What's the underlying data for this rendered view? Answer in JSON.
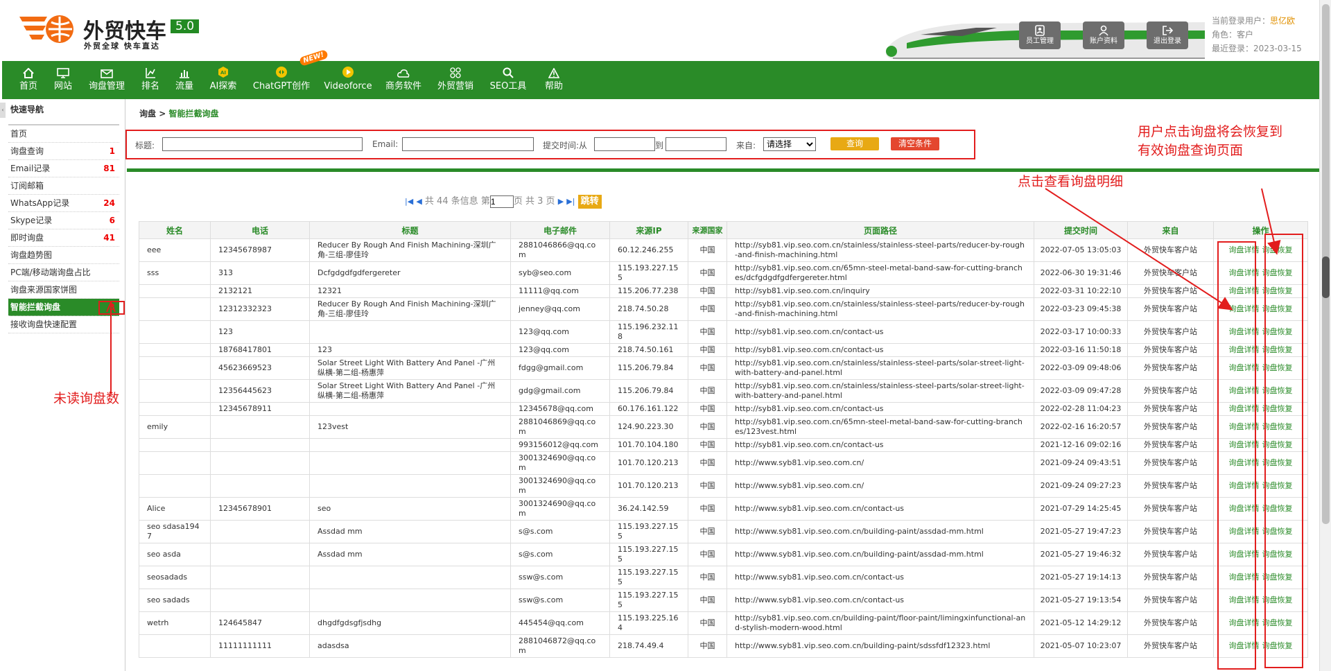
{
  "header": {
    "logo_title": "外贸快车",
    "logo_slogan": "外贸全球 快车直达",
    "version": "5.0",
    "buttons": [
      {
        "label": "员工管理",
        "icon": "staff-icon"
      },
      {
        "label": "账户资料",
        "icon": "account-icon"
      },
      {
        "label": "退出登录",
        "icon": "logout-icon"
      }
    ],
    "user_label": "当前登录用户：",
    "user_name": "思亿欧",
    "role_label": "角色：",
    "role": "客户",
    "last_login_label": "最近登录：",
    "last_login": "2023-03-15"
  },
  "nav": {
    "items": [
      {
        "label": "首页",
        "icon": "home-icon"
      },
      {
        "label": "网站",
        "icon": "monitor-icon"
      },
      {
        "label": "询盘管理",
        "icon": "mail-icon"
      },
      {
        "label": "排名",
        "icon": "rank-chart-icon"
      },
      {
        "label": "流量",
        "icon": "bar-chart-icon"
      },
      {
        "label": "AI探索",
        "icon": "ai-icon"
      },
      {
        "label": "ChatGPT创作",
        "icon": "chatgpt-icon"
      },
      {
        "label": "Videoforce",
        "icon": "play-icon"
      },
      {
        "label": "商务软件",
        "icon": "cloud-icon"
      },
      {
        "label": "外贸营销",
        "icon": "grid-icon"
      },
      {
        "label": "SEO工具",
        "icon": "search-icon"
      },
      {
        "label": "帮助",
        "icon": "warning-icon"
      }
    ],
    "new_badge": "NEW!"
  },
  "sidebar": {
    "title": "快速导航",
    "items": [
      {
        "label": "首页",
        "count": ""
      },
      {
        "label": "询盘查询",
        "count": "1"
      },
      {
        "label": "Email记录",
        "count": "81"
      },
      {
        "label": "订阅邮箱",
        "count": ""
      },
      {
        "label": "WhatsApp记录",
        "count": "24"
      },
      {
        "label": "Skype记录",
        "count": "6"
      },
      {
        "label": "即时询盘",
        "count": "41"
      },
      {
        "label": "询盘趋势图",
        "count": ""
      },
      {
        "label": "PC端/移动端询盘占比",
        "count": ""
      },
      {
        "label": "询盘来源国家饼图",
        "count": ""
      },
      {
        "label": "智能拦截询盘",
        "count": "3"
      },
      {
        "label": "接收询盘快速配置",
        "count": ""
      }
    ]
  },
  "breadcrumb": {
    "parent": "询盘",
    "sep": " > ",
    "current": "智能拦截询盘"
  },
  "filter": {
    "title_label": "标题:",
    "email_label": "Email:",
    "time_label": "提交时间:",
    "from_label": "从",
    "to_label": "到",
    "source_label": "来自:",
    "source_value": "请选择",
    "query_button": "查询",
    "clear_button": "清空条件"
  },
  "pager": {
    "prefix": "共 44 条信息 第",
    "page": "1",
    "suffix": "页 共 3 页",
    "jump_button": "跳转"
  },
  "table": {
    "headers": [
      "姓名",
      "电话",
      "标题",
      "电子邮件",
      "来源IP",
      "来源国家",
      "页面路径",
      "提交时间",
      "来自",
      "操作"
    ],
    "detail_label": "询盘详情",
    "restore_label": "询盘恢复",
    "rows": [
      {
        "name": "eee",
        "phone": "12345678987",
        "title": "Reducer By Rough And Finish Machining-深圳广角-三组-廖佳玲",
        "email": "2881046866@qq.com",
        "ip": "60.12.246.255",
        "country": "中国",
        "path": "http://syb81.vip.seo.com.cn/stainless/stainless-steel-parts/reducer-by-rough-and-finish-machining.html",
        "time": "2022-07-05 13:05:03",
        "source": "外贸快车客户站"
      },
      {
        "name": "sss",
        "phone": "313",
        "title": "Dcfgdgdfgdfergereter",
        "email": "syb@seo.com",
        "ip": "115.193.227.155",
        "country": "中国",
        "path": "http://syb81.vip.seo.com.cn/65mn-steel-metal-band-saw-for-cutting-branches/dcfgdgdfgdfergereter.html",
        "time": "2022-06-30 19:31:46",
        "source": "外贸快车客户站"
      },
      {
        "name": "",
        "phone": "2132121",
        "title": "12321",
        "email": "11111@qq.com",
        "ip": "115.206.77.238",
        "country": "中国",
        "path": "http://syb81.vip.seo.com.cn/inquiry",
        "time": "2022-03-31 10:22:10",
        "source": "外贸快车客户站"
      },
      {
        "name": "",
        "phone": "12312332323",
        "title": "Reducer By Rough And Finish Machining-深圳广角-三组-廖佳玲",
        "email": "jenney@qq.com",
        "ip": "218.74.50.28",
        "country": "中国",
        "path": "http://syb81.vip.seo.com.cn/stainless/stainless-steel-parts/reducer-by-rough-and-finish-machining.html",
        "time": "2022-03-23 09:45:38",
        "source": "外贸快车客户站"
      },
      {
        "name": "",
        "phone": "123",
        "title": "",
        "email": "123@qq.com",
        "ip": "115.196.232.118",
        "country": "中国",
        "path": "http://syb81.vip.seo.com.cn/contact-us",
        "time": "2022-03-17 10:00:33",
        "source": "外贸快车客户站"
      },
      {
        "name": "",
        "phone": "18768417801",
        "title": "123",
        "email": "123@qq.com",
        "ip": "218.74.50.161",
        "country": "中国",
        "path": "http://syb81.vip.seo.com.cn/contact-us",
        "time": "2022-03-16 11:50:18",
        "source": "外贸快车客户站"
      },
      {
        "name": "",
        "phone": "45623669523",
        "title": "Solar Street Light With Battery And Panel -广州纵横-第二组-杨惠萍",
        "email": "fdgg@gmail.com",
        "ip": "115.206.79.84",
        "country": "中国",
        "path": "http://syb81.vip.seo.com.cn/stainless/stainless-steel-parts/solar-street-light-with-battery-and-panel.html",
        "time": "2022-03-09 09:48:06",
        "source": "外贸快车客户站"
      },
      {
        "name": "",
        "phone": "12356445623",
        "title": "Solar Street Light With Battery And Panel -广州纵横-第二组-杨惠萍",
        "email": "gdg@gmail.com",
        "ip": "115.206.79.84",
        "country": "中国",
        "path": "http://syb81.vip.seo.com.cn/stainless/stainless-steel-parts/solar-street-light-with-battery-and-panel.html",
        "time": "2022-03-09 09:47:28",
        "source": "外贸快车客户站"
      },
      {
        "name": "",
        "phone": "12345678911",
        "title": "",
        "email": "12345678@qq.com",
        "ip": "60.176.161.122",
        "country": "中国",
        "path": "http://syb81.vip.seo.com.cn/contact-us",
        "time": "2022-02-28 11:04:23",
        "source": "外贸快车客户站"
      },
      {
        "name": "emily",
        "phone": "",
        "title": "123vest",
        "email": "2881046869@qq.com",
        "ip": "124.90.223.30",
        "country": "中国",
        "path": "http://syb81.vip.seo.com.cn/65mn-steel-metal-band-saw-for-cutting-branches/123vest.html",
        "time": "2022-02-16 16:20:57",
        "source": "外贸快车客户站"
      },
      {
        "name": "",
        "phone": "",
        "title": "",
        "email": "993156012@qq.com",
        "ip": "101.70.104.180",
        "country": "中国",
        "path": "http://syb81.vip.seo.com.cn/contact-us",
        "time": "2021-12-16 09:02:16",
        "source": "外贸快车客户站"
      },
      {
        "name": "",
        "phone": "",
        "title": "",
        "email": "3001324690@qq.com",
        "ip": "101.70.120.213",
        "country": "中国",
        "path": "http://www.syb81.vip.seo.com.cn/",
        "time": "2021-09-24 09:43:51",
        "source": "外贸快车客户站"
      },
      {
        "name": "",
        "phone": "",
        "title": "",
        "email": "3001324690@qq.com",
        "ip": "101.70.120.213",
        "country": "中国",
        "path": "http://www.syb81.vip.seo.com.cn/",
        "time": "2021-09-24 09:27:23",
        "source": "外贸快车客户站"
      },
      {
        "name": "Alice",
        "phone": "12345678901",
        "title": "seo",
        "email": "3001324690@qq.com",
        "ip": "36.24.142.59",
        "country": "中国",
        "path": "http://www.syb81.vip.seo.com.cn/contact-us",
        "time": "2021-07-29 14:25:45",
        "source": "外贸快车客户站"
      },
      {
        "name": "seo sdasa1947",
        "phone": "",
        "title": "Assdad mm",
        "email": "s@s.com",
        "ip": "115.193.227.155",
        "country": "中国",
        "path": "http://www.syb81.vip.seo.com.cn/building-paint/assdad-mm.html",
        "time": "2021-05-27 19:47:23",
        "source": "外贸快车客户站"
      },
      {
        "name": "seo asda",
        "phone": "",
        "title": "Assdad mm",
        "email": "s@s.com",
        "ip": "115.193.227.155",
        "country": "中国",
        "path": "http://www.syb81.vip.seo.com.cn/building-paint/assdad-mm.html",
        "time": "2021-05-27 19:46:32",
        "source": "外贸快车客户站"
      },
      {
        "name": "seosadads",
        "phone": "",
        "title": "",
        "email": "ssw@s.com",
        "ip": "115.193.227.155",
        "country": "中国",
        "path": "http://www.syb81.vip.seo.com.cn/contact-us",
        "time": "2021-05-27 19:14:13",
        "source": "外贸快车客户站"
      },
      {
        "name": "seo sadads",
        "phone": "",
        "title": "",
        "email": "ssw@s.com",
        "ip": "115.193.227.155",
        "country": "中国",
        "path": "http://www.syb81.vip.seo.com.cn/contact-us",
        "time": "2021-05-27 19:13:54",
        "source": "外贸快车客户站"
      },
      {
        "name": "wetrh",
        "phone": "124645847",
        "title": "dhgdfgdsgfjsdhg",
        "email": "445454@qq.com",
        "ip": "115.193.225.164",
        "country": "中国",
        "path": "http://syb81.vip.seo.com.cn/building-paint/floor-paint/limingxinfunctional-and-stylish-modern-wood.html",
        "time": "2021-05-12 14:29:12",
        "source": "外贸快车客户站"
      },
      {
        "name": "",
        "phone": "11111111111",
        "title": "adasdsa",
        "email": "2881046872@qq.com",
        "ip": "218.74.49.4",
        "country": "中国",
        "path": "http://www.syb81.vip.seo.com.cn/building-paint/sdssfdf12323.html",
        "time": "2021-05-07 10:23:07",
        "source": "外贸快车客户站"
      }
    ]
  },
  "annotations": {
    "unread": "未读询盘数",
    "restore_line1": "用户点击询盘将会恢复到",
    "restore_line2": "有效询盘查询页面",
    "detail": "点击查看询盘明细"
  },
  "colors": {
    "brand_green": "#2a8b28",
    "accent_orange": "#e8a914",
    "clear_red": "#e4472f",
    "annotation_red": "#e21d1d"
  }
}
